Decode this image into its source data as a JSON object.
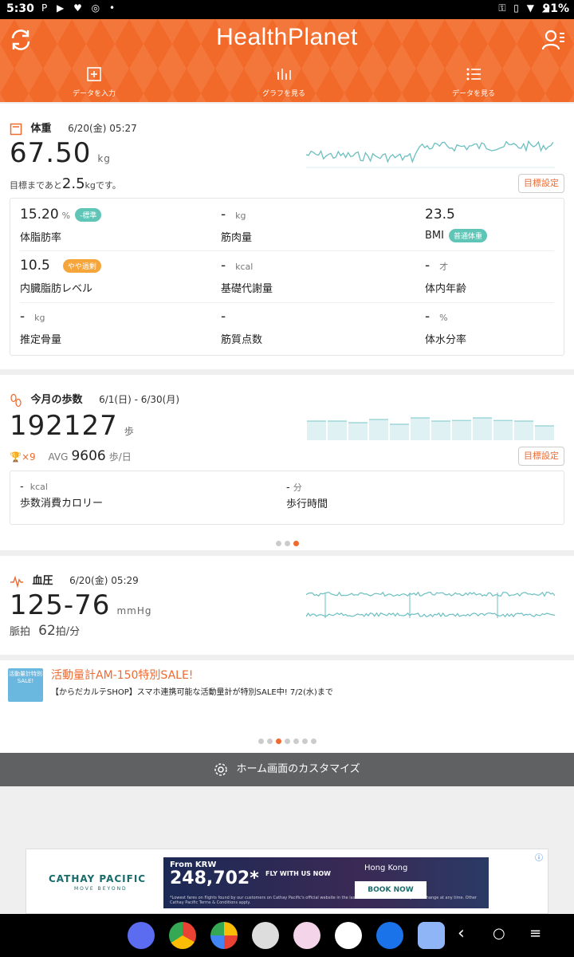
{
  "status": {
    "time": "5:30",
    "notif_icons": "P ▶ ♥ ◎ •",
    "sys_icons": "⚿ ▯ ▼ ◢",
    "battery": "91%"
  },
  "header": {
    "logo": "HealthPlanet",
    "tabs": [
      {
        "label": "データを入力",
        "icon": "plus-box-icon"
      },
      {
        "label": "グラフを見る",
        "icon": "bar-graph-icon"
      },
      {
        "label": "データを見る",
        "icon": "list-icon"
      }
    ]
  },
  "weight": {
    "title": "体重",
    "date": "6/20(金) 05:27",
    "value": "67.50",
    "unit": "kg",
    "goal_prefix": "目標まであと",
    "goal_value": "2.5",
    "goal_unit": "kg",
    "goal_suffix": "です。",
    "goal_button": "目標設定",
    "metrics": [
      {
        "value": "15.20",
        "unit": "%",
        "label": "体脂肪率",
        "badge": "-標準",
        "badge_color": "#5fc5b7"
      },
      {
        "value": "-",
        "unit": "kg",
        "label": "筋肉量",
        "badge": ""
      },
      {
        "value": "23.5",
        "unit": "",
        "label": "BMI",
        "badge": "普通体重",
        "badge_color": "#5fc5b7"
      },
      {
        "value": "10.5",
        "unit": "",
        "label": "内臓脂肪レベル",
        "badge": "やや過剰",
        "badge_color": "#f5a53a"
      },
      {
        "value": "-",
        "unit": "kcal",
        "label": "基礎代謝量",
        "badge": ""
      },
      {
        "value": "-",
        "unit": "才",
        "label": "体内年齢",
        "badge": ""
      },
      {
        "value": "-",
        "unit": "kg",
        "label": "推定骨量",
        "badge": ""
      },
      {
        "value": "-",
        "unit": "",
        "label": "筋質点数",
        "badge": ""
      },
      {
        "value": "-",
        "unit": "%",
        "label": "体水分率",
        "badge": ""
      }
    ]
  },
  "steps": {
    "title": "今月の歩数",
    "date": "6/1(日) - 6/30(月)",
    "value": "192127",
    "unit": "歩",
    "trophy_count": "×9",
    "avg_label": "AVG",
    "avg_value": "9606",
    "avg_unit": "歩/日",
    "goal_button": "目標設定",
    "calorie_value": "-",
    "calorie_unit": "kcal",
    "calorie_label": "歩数消費カロリー",
    "time_value": "-",
    "time_unit": "分",
    "time_label": "歩行時間",
    "bars": [
      0.6,
      0.6,
      0.55,
      0.65,
      0.5,
      0.7,
      0.6,
      0.62,
      0.7,
      0.62,
      0.6,
      0.45
    ]
  },
  "bp": {
    "title": "血圧",
    "date": "6/20(金) 05:29",
    "value": "125-76",
    "unit": "mmHg",
    "pulse_label": "脈拍",
    "pulse_value": "62",
    "pulse_unit": "拍/分"
  },
  "promo": {
    "image_text": "活動量計特別SALE!",
    "title": "活動量計AM-150特別SALE!",
    "text": "【からだカルテSHOP】スマホ連携可能な活動量計が特別SALE中! 7/2(水)まで"
  },
  "customize": {
    "label": "ホーム画面のカスタマイズ"
  },
  "ad": {
    "brand": "CATHAY PACIFIC",
    "tagline": "MOVE BEYOND",
    "from": "From KRW",
    "price": "248,702*",
    "fly": "FLY WITH US NOW",
    "city": "Hong Kong",
    "book": "BOOK NOW",
    "fine": "*Lowest fares on flights found by our customers on Cathay Pacific's official website in the last 24 hours. All fares are subject to change at any time. Other Cathay Pacific Terms & Conditions apply."
  },
  "colors": {
    "accent": "#f26a2a",
    "teal": "#5fc5b7",
    "chart": "#6cbfc0"
  }
}
